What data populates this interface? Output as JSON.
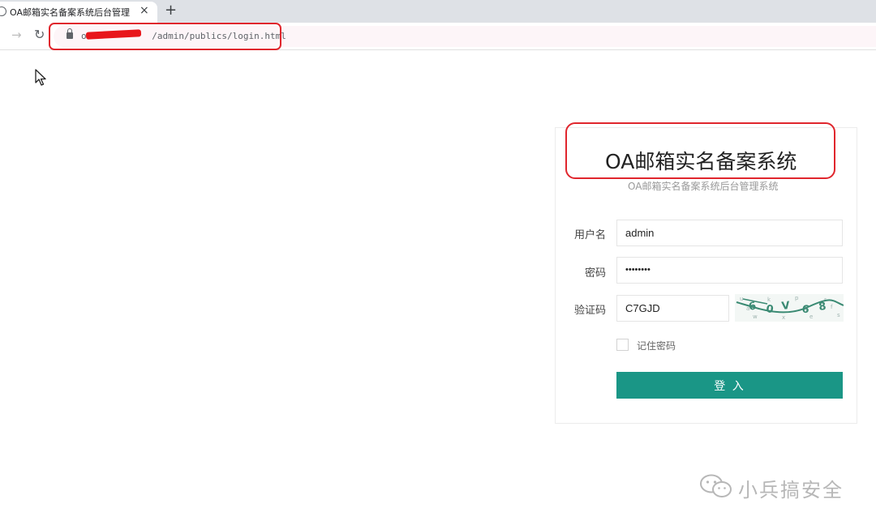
{
  "browser": {
    "tab_title": "OA邮箱实名备案系统后台管理",
    "tab_close": "×",
    "new_tab": "+",
    "forward_glyph": "→",
    "reload_glyph": "↻",
    "url_prefix": "oa",
    "url_path": "/admin/publics/login.html"
  },
  "login": {
    "title": "OA邮箱实名备案系统",
    "subtitle": "OA邮箱实名备案系统后台管理系统",
    "username_label": "用户名",
    "username_value": "admin",
    "password_label": "密码",
    "password_value": "••••••••",
    "captcha_label": "验证码",
    "captcha_value": "C7GJD",
    "remember_label": "记住密码",
    "submit_label": "登 入"
  },
  "colors": {
    "primary_button": "#1a9686",
    "annotation": "#e0262d",
    "redaction": "#e8161b"
  },
  "watermark": {
    "text": "小兵搞安全",
    "icon": "wechat-icon"
  }
}
